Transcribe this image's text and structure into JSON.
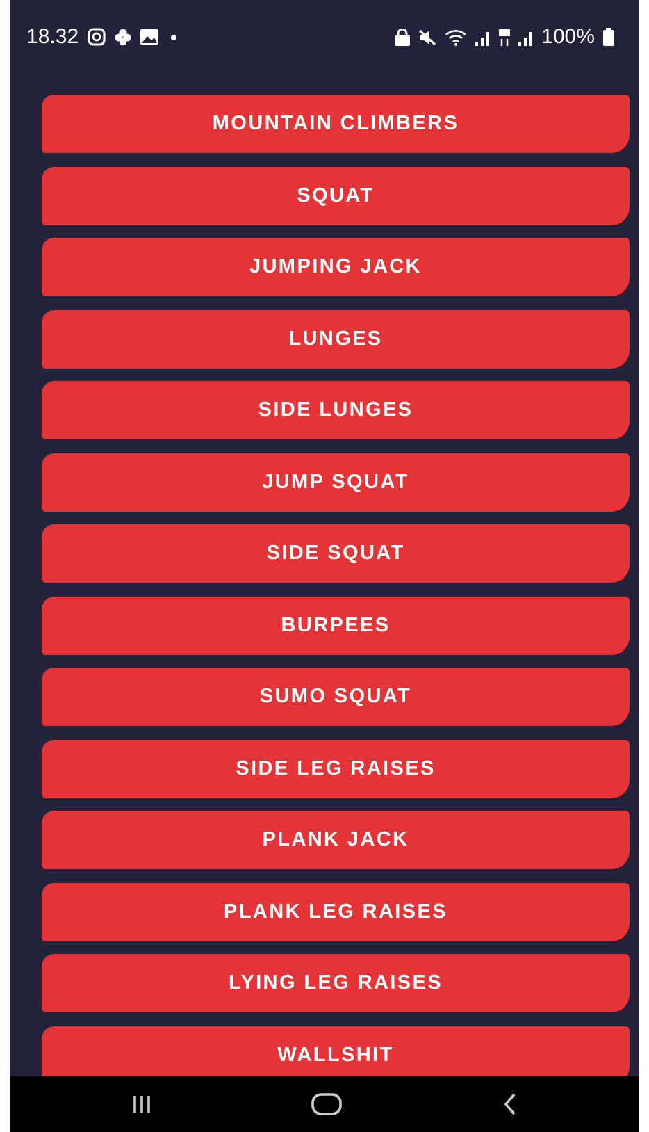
{
  "status_bar": {
    "time": "18.32",
    "battery": "100%"
  },
  "exercises": [
    {
      "label": "MOUNTAIN CLIMBERS"
    },
    {
      "label": "SQUAT"
    },
    {
      "label": "JUMPING JACK"
    },
    {
      "label": "LUNGES"
    },
    {
      "label": "SIDE LUNGES"
    },
    {
      "label": "JUMP SQUAT"
    },
    {
      "label": "SIDE SQUAT"
    },
    {
      "label": "BURPEES"
    },
    {
      "label": "SUMO SQUAT"
    },
    {
      "label": "SIDE LEG RAISES"
    },
    {
      "label": "PLANK JACK"
    },
    {
      "label": "PLANK LEG RAISES"
    },
    {
      "label": "LYING LEG RAISES"
    },
    {
      "label": "WALLSHIT"
    }
  ]
}
